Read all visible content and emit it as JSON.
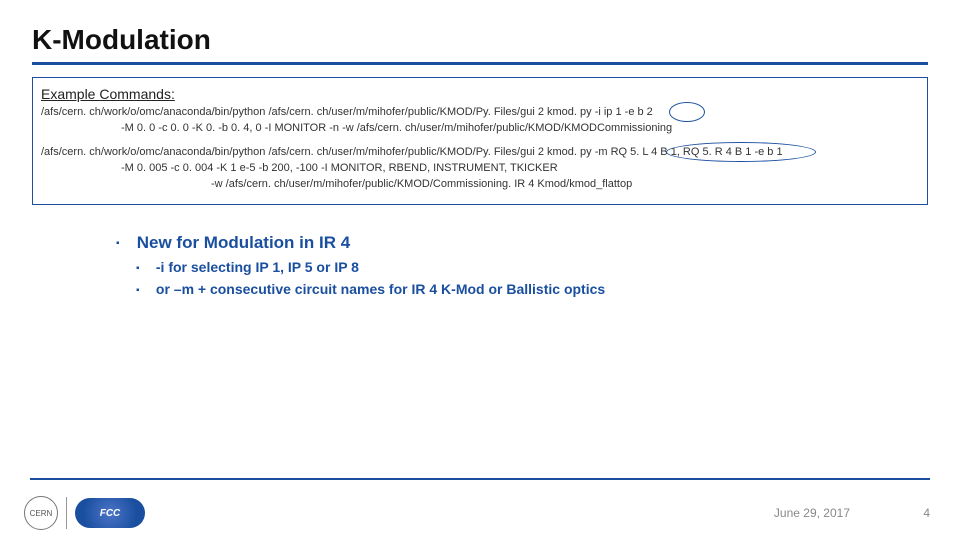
{
  "title": "K-Modulation",
  "box": {
    "header": "Example Commands:",
    "lines": [
      "/afs/cern. ch/work/o/omc/anaconda/bin/python  /afs/cern. ch/user/m/mihofer/public/KMOD/Py. Files/gui 2 kmod. py  -i ip 1 -e b 2",
      "-M 0. 0 -c 0. 0 -K 0.  -b 0. 4, 0 -I MONITOR  -n -w /afs/cern. ch/user/m/mihofer/public/KMOD/KMODCommissioning",
      "/afs/cern. ch/work/o/omc/anaconda/bin/python  /afs/cern. ch/user/m/mihofer/public/KMOD/Py. Files/gui 2 kmod. py  -m RQ 5. L 4 B 1, RQ 5. R 4 B 1 -e b 1",
      "-M 0. 005 -c 0. 004 -K 1 e-5 -b 200, -100 -I MONITOR, RBEND, INSTRUMENT, TKICKER",
      "-w /afs/cern. ch/user/m/mihofer/public/KMOD/Commissioning. IR 4 Kmod/kmod_flattop"
    ]
  },
  "bullets": {
    "l1": "New for Modulation in IR 4",
    "l2a": "-i for selecting IP 1, IP 5 or IP 8",
    "l2b": "or –m + consecutive circuit names for IR 4 K-Mod or Ballistic optics"
  },
  "footer": {
    "logo1": "CERN",
    "logo2": "FCC",
    "date": "June 29, 2017",
    "page": "4"
  }
}
